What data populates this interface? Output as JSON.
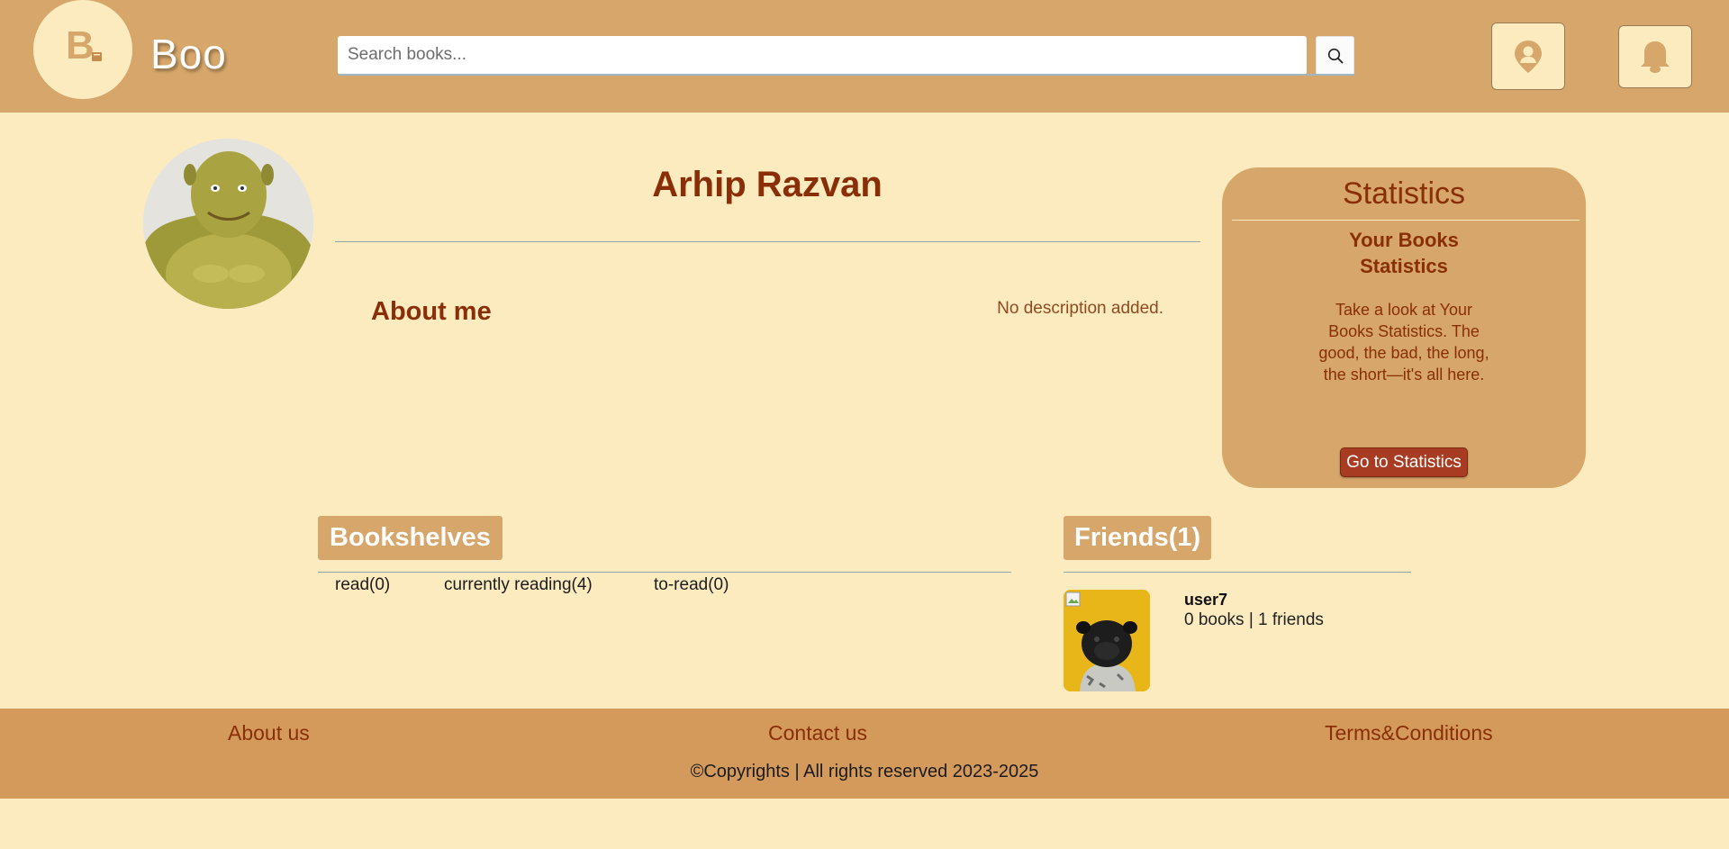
{
  "header": {
    "logo_letter": "B",
    "brand": "Boo",
    "search_placeholder": "Search books...",
    "icons": {
      "search": "search-icon",
      "location": "location-pin-icon",
      "bell": "bell-icon"
    }
  },
  "profile": {
    "name": "Arhip Razvan",
    "about_heading": "About me",
    "about_text": "No description added."
  },
  "statistics": {
    "title": "Statistics",
    "subtitle": "Your Books Statistics",
    "description": "Take a look at Your Books Statistics. The good, the bad, the long, the short—it's all here.",
    "button": "Go to Statistics"
  },
  "bookshelves": {
    "heading": "Bookshelves",
    "tabs": [
      "read(0)",
      "currently reading(4)",
      "to-read(0)"
    ]
  },
  "friends": {
    "heading": "Friends(1)",
    "list": [
      {
        "name": "user7",
        "meta": "0 books | 1 friends"
      }
    ]
  },
  "footer": {
    "links": [
      "About us",
      "Contact us",
      "Terms&Conditions"
    ],
    "copyright": "©Copyrights | All rights reserved 2023-2025"
  },
  "colors": {
    "header_bg": "#d6a66a",
    "page_bg": "#fdebc0",
    "accent_text": "#8a2e07",
    "button_bg": "#a83c22",
    "footer_bg": "#d49a5c"
  }
}
